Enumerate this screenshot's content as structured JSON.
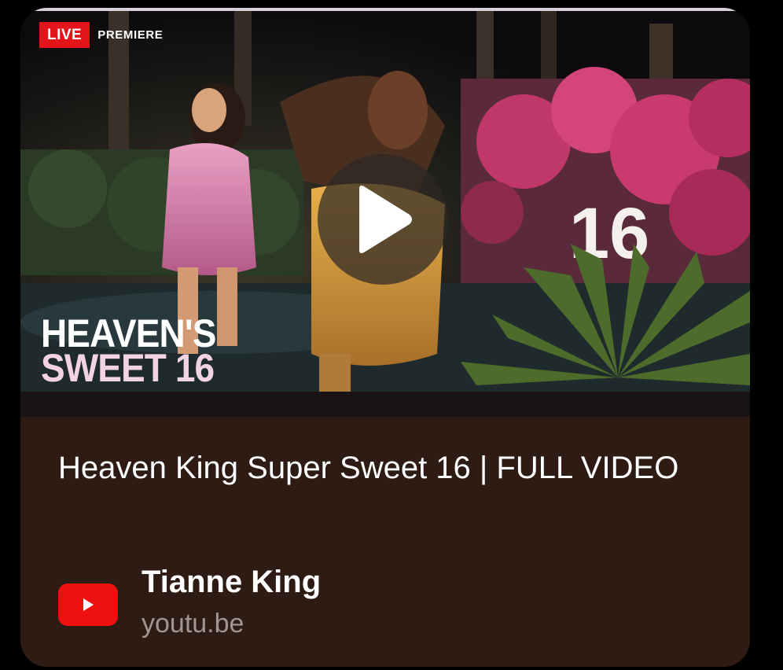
{
  "thumbnail": {
    "live_badge": "LIVE",
    "premiere_label": "PREMIERE",
    "overlay_title_line1": "HEAVEN'S",
    "overlay_title_line2": "SWEET 16",
    "sign_text": "16",
    "icons": {
      "play": "play-icon"
    }
  },
  "video": {
    "title": "Heaven King Super Sweet 16 | FULL VIDEO",
    "channel": "Tianne King",
    "domain": "youtu.be",
    "source_icon": "youtube-logo-icon"
  },
  "colors": {
    "live_red": "#e3151b",
    "card_background": "#2e1c14",
    "youtube_red": "#ee0f0f"
  }
}
